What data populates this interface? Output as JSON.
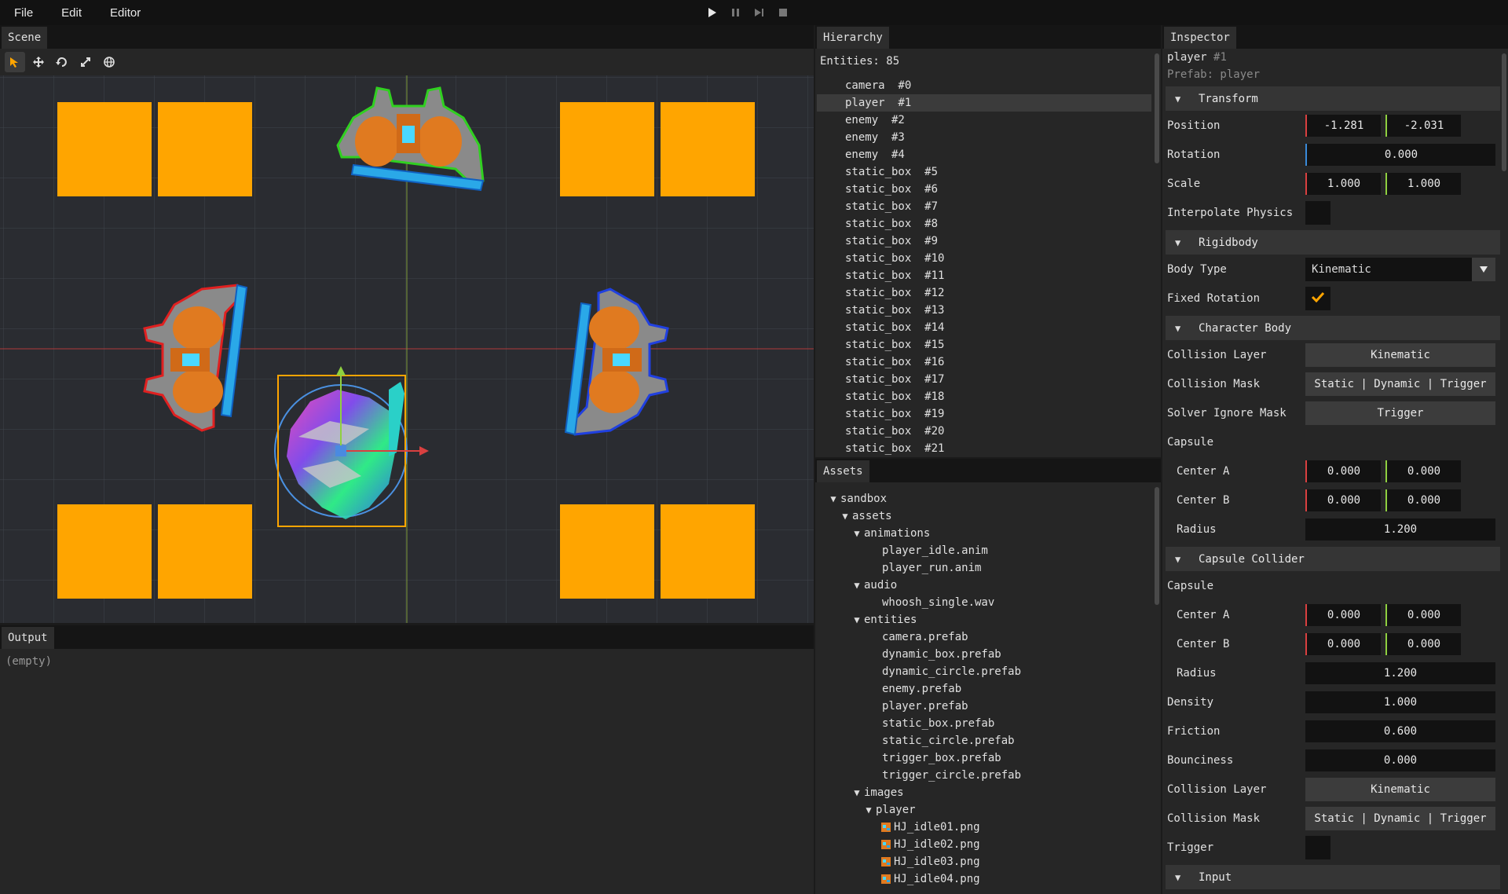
{
  "menubar": {
    "items": [
      "File",
      "Edit",
      "Editor"
    ]
  },
  "play_controls": [
    "play-icon",
    "pause-icon",
    "step-icon",
    "stop-icon"
  ],
  "scene": {
    "tab": "Scene",
    "tools": [
      "select-tool",
      "move-tool",
      "rotate-tool",
      "scale-tool",
      "world-tool"
    ],
    "accent": "#ffa500"
  },
  "output": {
    "tab": "Output",
    "text": "(empty)"
  },
  "hierarchy": {
    "tab": "Hierarchy",
    "count": "Entities: 85",
    "items": [
      {
        "label": "camera  #0"
      },
      {
        "label": "player  #1",
        "selected": true
      },
      {
        "label": "enemy  #2"
      },
      {
        "label": "enemy  #3"
      },
      {
        "label": "enemy  #4"
      },
      {
        "label": "static_box  #5"
      },
      {
        "label": "static_box  #6"
      },
      {
        "label": "static_box  #7"
      },
      {
        "label": "static_box  #8"
      },
      {
        "label": "static_box  #9"
      },
      {
        "label": "static_box  #10"
      },
      {
        "label": "static_box  #11"
      },
      {
        "label": "static_box  #12"
      },
      {
        "label": "static_box  #13"
      },
      {
        "label": "static_box  #14"
      },
      {
        "label": "static_box  #15"
      },
      {
        "label": "static_box  #16"
      },
      {
        "label": "static_box  #17"
      },
      {
        "label": "static_box  #18"
      },
      {
        "label": "static_box  #19"
      },
      {
        "label": "static_box  #20"
      },
      {
        "label": "static_box  #21"
      }
    ]
  },
  "assets": {
    "tab": "Assets",
    "tree": [
      {
        "label": "sandbox",
        "depth": 0,
        "folder": true
      },
      {
        "label": "assets",
        "depth": 1,
        "folder": true
      },
      {
        "label": "animations",
        "depth": 2,
        "folder": true
      },
      {
        "label": "player_idle.anim",
        "depth": 3
      },
      {
        "label": "player_run.anim",
        "depth": 3
      },
      {
        "label": "audio",
        "depth": 2,
        "folder": true
      },
      {
        "label": "whoosh_single.wav",
        "depth": 3
      },
      {
        "label": "entities",
        "depth": 2,
        "folder": true
      },
      {
        "label": "camera.prefab",
        "depth": 3
      },
      {
        "label": "dynamic_box.prefab",
        "depth": 3
      },
      {
        "label": "dynamic_circle.prefab",
        "depth": 3
      },
      {
        "label": "enemy.prefab",
        "depth": 3
      },
      {
        "label": "player.prefab",
        "depth": 3
      },
      {
        "label": "static_box.prefab",
        "depth": 3
      },
      {
        "label": "static_circle.prefab",
        "depth": 3
      },
      {
        "label": "trigger_box.prefab",
        "depth": 3
      },
      {
        "label": "trigger_circle.prefab",
        "depth": 3
      },
      {
        "label": "images",
        "depth": 2,
        "folder": true
      },
      {
        "label": "player",
        "depth": 3,
        "folder": true
      },
      {
        "label": "HJ_idle01.png",
        "depth": 4,
        "image": true
      },
      {
        "label": "HJ_idle02.png",
        "depth": 4,
        "image": true
      },
      {
        "label": "HJ_idle03.png",
        "depth": 4,
        "image": true
      },
      {
        "label": "HJ_idle04.png",
        "depth": 4,
        "image": true
      }
    ]
  },
  "inspector": {
    "tab": "Inspector",
    "entity_name": "player",
    "entity_id": "#1",
    "prefab": "Prefab: player",
    "rows": [
      {
        "kind": "section",
        "label": "Transform"
      },
      {
        "kind": "vec2",
        "label": "Position",
        "x": "-1.281",
        "y": "-2.031"
      },
      {
        "kind": "float_z",
        "label": "Rotation",
        "value": "0.000"
      },
      {
        "kind": "vec2",
        "label": "Scale",
        "x": "1.000",
        "y": "1.000"
      },
      {
        "kind": "check",
        "label": "Interpolate Physics",
        "checked": false
      },
      {
        "kind": "section",
        "label": "Rigidbody"
      },
      {
        "kind": "combo",
        "label": "Body Type",
        "value": "Kinematic"
      },
      {
        "kind": "check",
        "label": "Fixed Rotation",
        "checked": true
      },
      {
        "kind": "section",
        "label": "Character Body"
      },
      {
        "kind": "button",
        "label": "Collision Layer",
        "value": "Kinematic"
      },
      {
        "kind": "button",
        "label": "Collision Mask",
        "value": "Static | Dynamic | Trigger"
      },
      {
        "kind": "button",
        "label": "Solver Ignore Mask",
        "value": "Trigger"
      },
      {
        "kind": "label",
        "label": "Capsule"
      },
      {
        "kind": "vec2",
        "label": "Center A",
        "x": "0.000",
        "y": "0.000",
        "indent": true
      },
      {
        "kind": "vec2",
        "label": "Center B",
        "x": "0.000",
        "y": "0.000",
        "indent": true
      },
      {
        "kind": "float",
        "label": "Radius",
        "value": "1.200",
        "indent": true
      },
      {
        "kind": "section",
        "label": "Capsule Collider"
      },
      {
        "kind": "label",
        "label": "Capsule"
      },
      {
        "kind": "vec2",
        "label": "Center A",
        "x": "0.000",
        "y": "0.000",
        "indent": true
      },
      {
        "kind": "vec2",
        "label": "Center B",
        "x": "0.000",
        "y": "0.000",
        "indent": true
      },
      {
        "kind": "float",
        "label": "Radius",
        "value": "1.200",
        "indent": true
      },
      {
        "kind": "float",
        "label": "Density",
        "value": "1.000"
      },
      {
        "kind": "float",
        "label": "Friction",
        "value": "0.600"
      },
      {
        "kind": "float",
        "label": "Bounciness",
        "value": "0.000"
      },
      {
        "kind": "button",
        "label": "Collision Layer",
        "value": "Kinematic"
      },
      {
        "kind": "button",
        "label": "Collision Mask",
        "value": "Static | Dynamic | Trigger"
      },
      {
        "kind": "check",
        "label": "Trigger",
        "checked": false
      },
      {
        "kind": "section",
        "label": "Input"
      }
    ]
  }
}
